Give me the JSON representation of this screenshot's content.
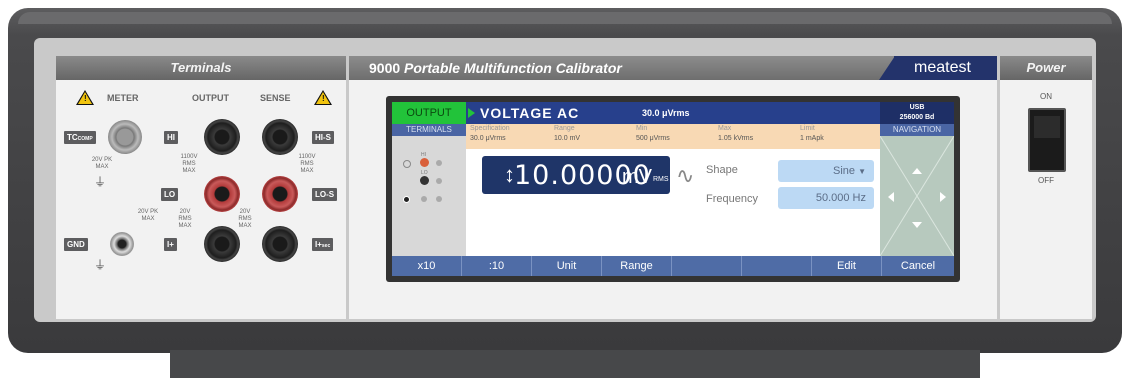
{
  "device": {
    "model": "9000",
    "title": "Portable Multifunction Calibrator",
    "brand": "meatest"
  },
  "terminals": {
    "header": "Terminals",
    "meter_label": "METER",
    "output_label": "OUTPUT",
    "sense_label": "SENSE",
    "tags": {
      "tc": "TC",
      "tc_sub": "COMP",
      "hi": "HI",
      "lo": "LO",
      "gnd": "GND",
      "i_plus": "I+",
      "hi_s": "HI-S",
      "lo_s": "LO-S",
      "i_plus_sec": "I+",
      "i_plus_sec_sub": "sec"
    },
    "ratings": {
      "meter": "20V PK\nMAX",
      "hi": "1100V\nRMS\nMAX",
      "hi_s": "1100V\nRMS\nMAX",
      "lo_left": "20V PK\nMAX",
      "lo_mid": "20V\nRMS\nMAX",
      "lo_right": "20V\nRMS\nMAX"
    }
  },
  "screen": {
    "output_tab": "OUTPUT",
    "function": "VOLTAGE AC",
    "amplitude": "30.0 μVrms",
    "usb": "USB",
    "baud": "256000 Bd",
    "terminals_label": "TERMINALS",
    "navigation_label": "NAVIGATION",
    "term_hi": "HI",
    "term_lo": "LO",
    "info": [
      {
        "label": "Specification",
        "value": "30.0 μVrms"
      },
      {
        "label": "Range",
        "value": "10.0 mV"
      },
      {
        "label": "Min",
        "value": "500 μVrms"
      },
      {
        "label": "Max",
        "value": "1.05 kVrms"
      },
      {
        "label": "Limit",
        "value": "1 mApk"
      }
    ],
    "value": "10.00000",
    "unit": "mV",
    "unit_sub": "RMS",
    "shape_label": "Shape",
    "shape_value": "Sine",
    "frequency_label": "Frequency",
    "frequency_value": "50.000 Hz",
    "softkeys": [
      "x10",
      ":10",
      "Unit",
      "Range",
      "",
      "",
      "Edit",
      "Cancel"
    ]
  },
  "power": {
    "header": "Power",
    "on": "ON",
    "off": "OFF"
  },
  "colors": {
    "screen_title_bar": "#27408c",
    "output_tab": "#22c33a",
    "brand_bg": "#23336b",
    "softkey_bar": "#4f6ca6",
    "info_bar": "#f8d9b4"
  }
}
